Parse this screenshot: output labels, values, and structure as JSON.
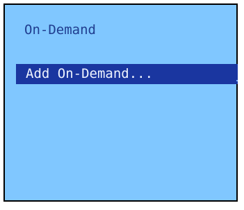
{
  "screen": {
    "title": "On-Demand",
    "menu_items": [
      {
        "label": "Add On-Demand...",
        "selected": true
      }
    ]
  },
  "colors": {
    "background": "#80c7ff",
    "title_text": "#1f3d8f",
    "selection_background": "#1a36a0",
    "selection_text": "#eef3ff",
    "border": "#000000"
  }
}
